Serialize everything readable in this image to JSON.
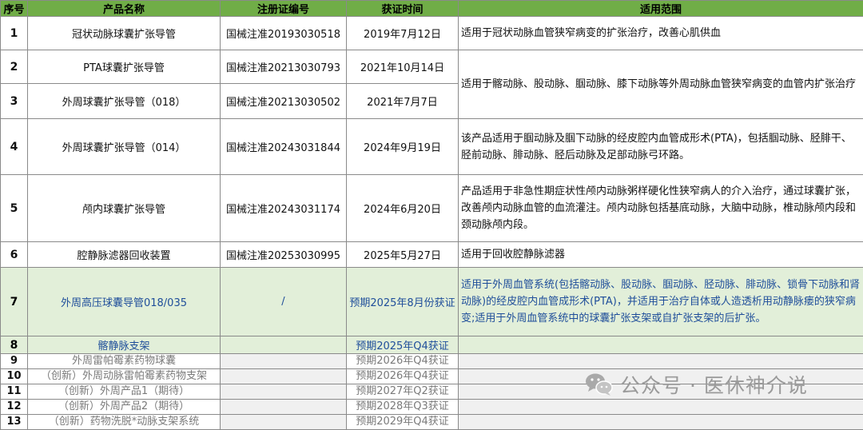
{
  "headers": [
    "序号",
    "产品名称",
    "注册证编号",
    "获证时间",
    "适用范围"
  ],
  "rows": [
    {
      "idx": "1",
      "name": "冠状动脉球囊扩张导管",
      "reg": "国械注准20193030518",
      "date": "2019年7月12日",
      "scope": "适用于冠状动脉血管狭窄病变的扩张治疗，改善心肌供血"
    },
    {
      "idx": "2",
      "name": "PTA球囊扩张导管",
      "reg": "国械注准20213030793",
      "date": "2021年10月14日",
      "scope": "适用于髂动脉、股动脉、腘动脉、膝下动脉等外周动脉血管狭窄病变的血管内扩张治疗"
    },
    {
      "idx": "3",
      "name": "外周球囊扩张导管（018）",
      "reg": "国械注准20213030502",
      "date": "2021年7月7日",
      "scope": ""
    },
    {
      "idx": "4",
      "name": "外周球囊扩张导管（014）",
      "reg": "国械注准20243031844",
      "date": "2024年9月19日",
      "scope": "该产品适用于腘动脉及腘下动脉的经皮腔内血管成形术(PTA)，包括腘动脉、胫腓干、胫前动脉、腓动脉、胫后动脉及足部动脉弓环路。"
    },
    {
      "idx": "5",
      "name": "颅内球囊扩张导管",
      "reg": "国械注准20243031174",
      "date": "2024年6月20日",
      "scope": "产品适用于非急性期症状性颅内动脉粥样硬化性狭窄病人的介入治疗，通过球囊扩张，改善颅内动脉血管的血流灌注。颅内动脉包括基底动脉，大脑中动脉，椎动脉颅内段和颈动脉颅内段。"
    },
    {
      "idx": "6",
      "name": "腔静脉滤器回收装置",
      "reg": "国械注准20253030995",
      "date": "2025年5月27日",
      "scope": "适用于回收腔静脉滤器"
    },
    {
      "idx": "7",
      "name": "外周高压球囊导管018/035",
      "reg": "/",
      "date": "预期2025年8月份获证",
      "scope": "适用于外周血管系统(包括髂动脉、股动脉、腘动脉、胫动脉、腓动脉、锁骨下动脉和肾动脉)的经皮腔内血管成形术(PTA)，并适用于治疗自体或人造透析用动静脉瘘的狭窄病变;适用于外周血管系统中的球囊扩张支架或自扩张支架的后扩张。"
    },
    {
      "idx": "8",
      "name": "髂静脉支架",
      "reg": "",
      "date": "预期2025年Q4获证",
      "scope": ""
    },
    {
      "idx": "9",
      "name": "外周雷帕霉素药物球囊",
      "reg": "",
      "date": "预期2026年Q4获证",
      "scope": ""
    },
    {
      "idx": "10",
      "name": "（创新）外周动脉雷帕霉素药物支架",
      "reg": "",
      "date": "预期2026年Q4获证",
      "scope": ""
    },
    {
      "idx": "11",
      "name": "（创新）外周产品1（期待）",
      "reg": "",
      "date": "预期2027年Q2获证",
      "scope": ""
    },
    {
      "idx": "12",
      "name": "（创新）外周产品2（期待）",
      "reg": "",
      "date": "预期2028年Q3获证",
      "scope": ""
    },
    {
      "idx": "13",
      "name": "（创新）药物洗脱*动脉支架系统",
      "reg": "",
      "date": "预期2029年Q4获证",
      "scope": ""
    }
  ],
  "watermark": {
    "text": "公众号 · 医休神介说",
    "icon": "wechat-icon"
  },
  "colors": {
    "header": "#70ad47",
    "highlight_row": "#e2efd9",
    "highlight_text": "#1f4e9a",
    "future_text": "#7a7a7a"
  }
}
